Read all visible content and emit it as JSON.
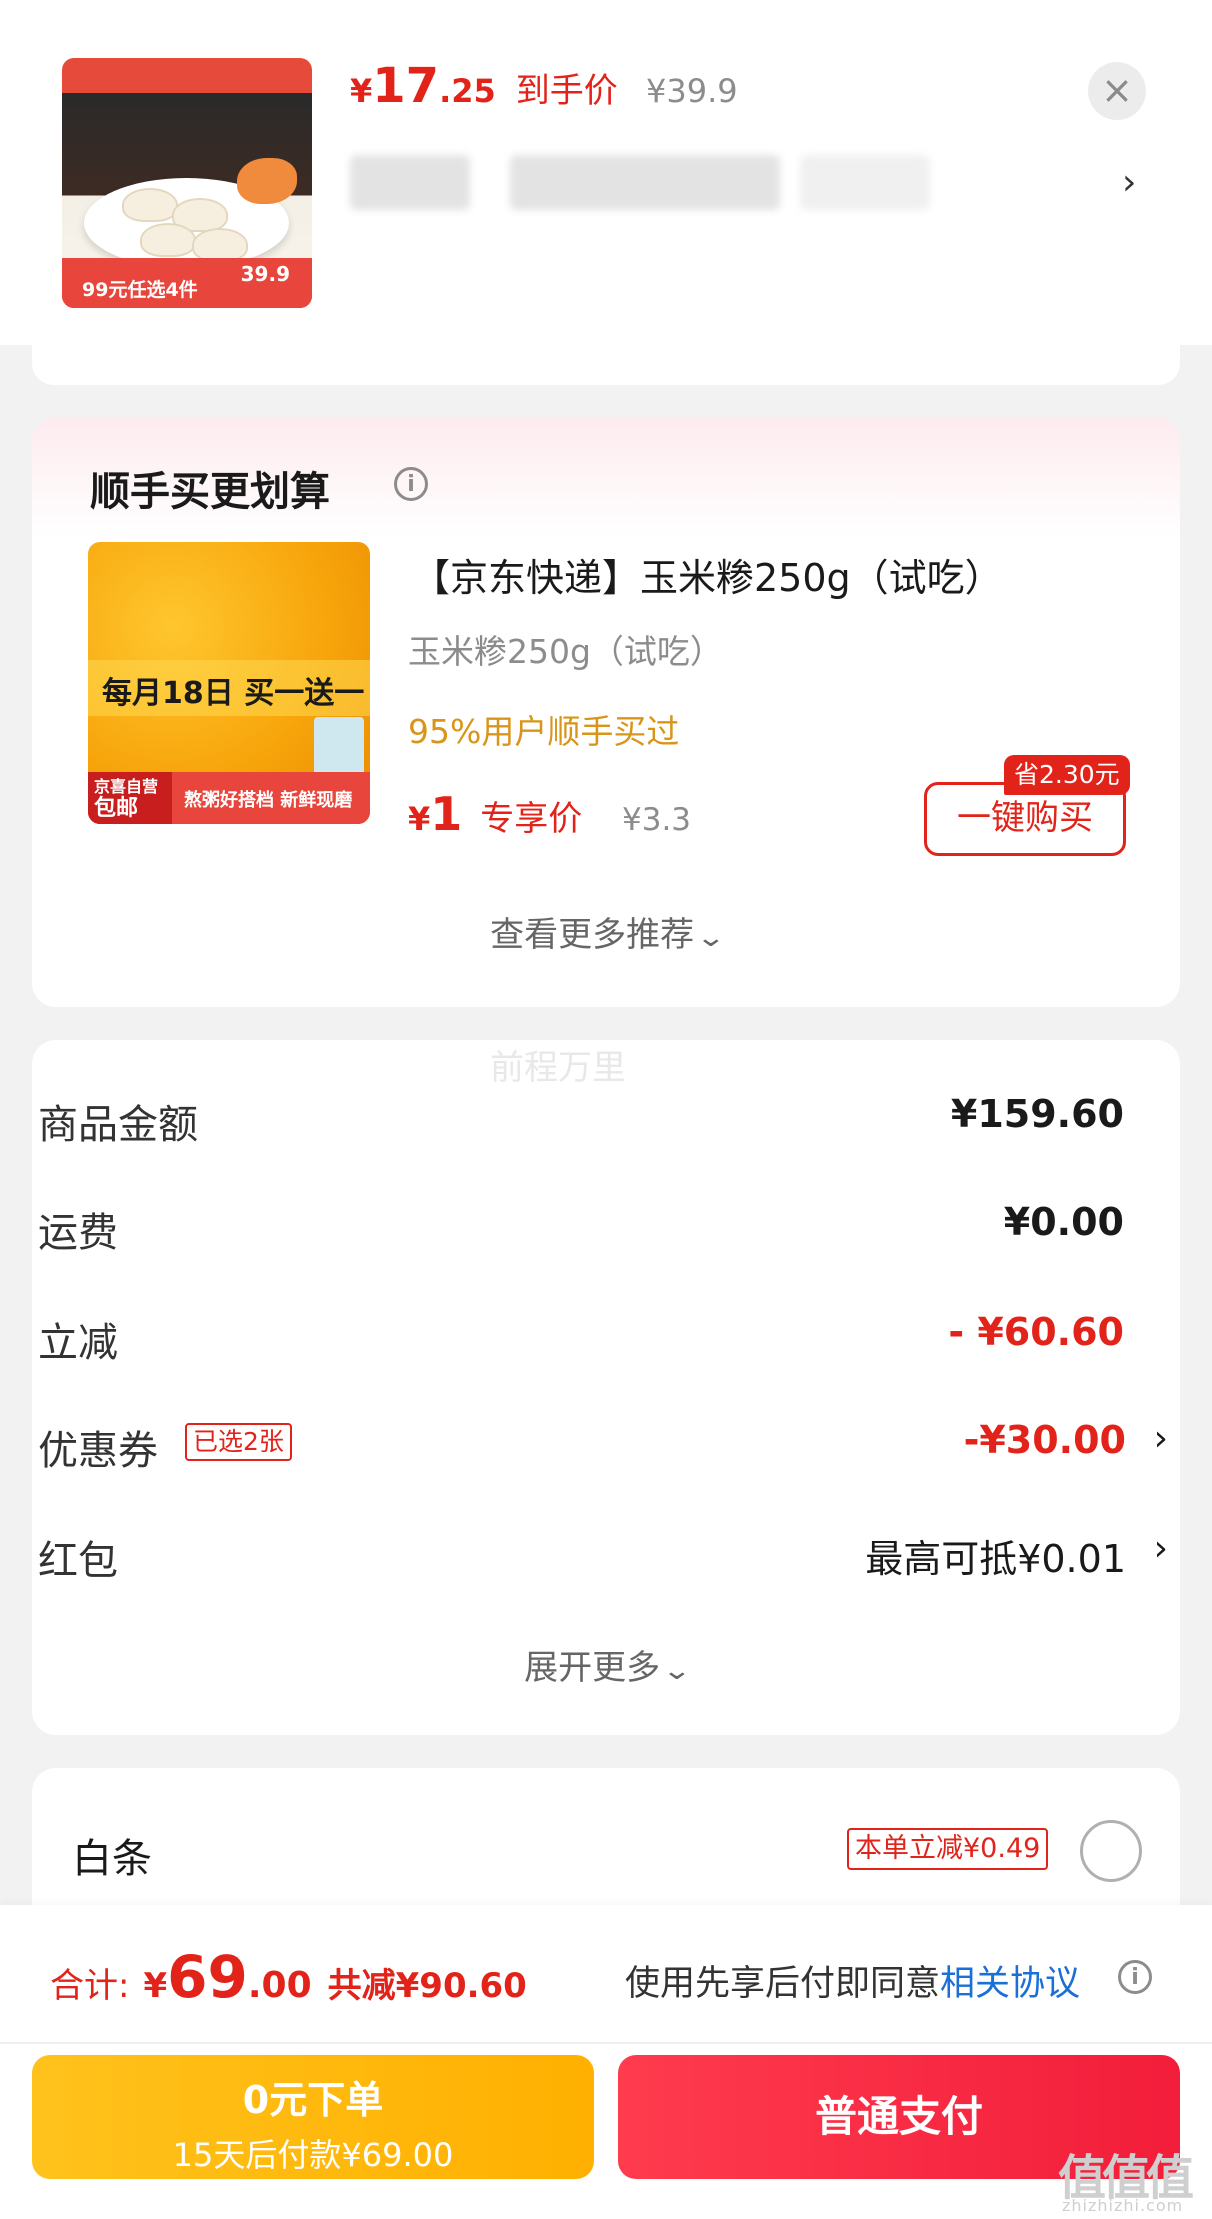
{
  "top_product": {
    "price_yen": "¥",
    "price_int": "17",
    "price_dec": ".25",
    "price_label": "到手价",
    "original_price": "¥39.9",
    "thumb_promo": "99元任选4件",
    "thumb_price": "39.9",
    "close_icon": "×",
    "arrow": "›"
  },
  "recommend": {
    "title": "顺手买更划算",
    "info_icon": "i",
    "thumb_banner": "每月18日 买一送一",
    "thumb_badge_top": "京喜自营",
    "thumb_badge_bottom": "包邮",
    "thumb_slogan": "熬粥好搭档  新鲜现磨",
    "name": "【京东快递】玉米糁250g（试吃）",
    "spec": "玉米糁250g（试吃）",
    "rate": "95%用户顺手买过",
    "price_yen": "¥",
    "price_int": "1",
    "price_label": "专享价",
    "original_price": "¥3.3",
    "buy_label": "一键购买",
    "save_tag": "省2.30元",
    "see_more": "查看更多推荐"
  },
  "summary": {
    "watermark": "前程万里",
    "rows": [
      {
        "label": "商品金额",
        "value": "¥159.60"
      },
      {
        "label": "运费",
        "value": "¥0.00"
      },
      {
        "label": "立减",
        "value": "- ¥60.60"
      },
      {
        "label": "优惠券",
        "value": "-¥30.00",
        "badge": "已选2张"
      },
      {
        "label": "红包",
        "value": "最高可抵¥0.01"
      }
    ],
    "arrow": "›",
    "expand": "展开更多"
  },
  "baitiao": {
    "label": "白条",
    "badge": "本单立减¥0.49"
  },
  "bottom": {
    "total_label": "合计:",
    "total_yen": "¥",
    "total_int": "69",
    "total_dec": ".00",
    "total_saved": "共减¥90.60",
    "agree_text": "使用先享后付即同意",
    "agree_link": "相关协议",
    "info_icon": "i",
    "later_line1": "0元下单",
    "later_line2": "15天后付款¥69.00",
    "pay_label": "普通支付"
  },
  "watermark_site": {
    "logo": "值值值",
    "url": "zhizhizhi.com"
  },
  "colors": {
    "accent_red": "#e2231a",
    "link_blue": "#1c6fd6",
    "rate_orange": "#d9951a",
    "pay_yellow": "#ffb000",
    "pay_red": "#f21d3a"
  },
  "icons": [
    "close-icon",
    "chevron-right-icon",
    "info-icon",
    "chevron-down-icon",
    "radio-icon"
  ]
}
